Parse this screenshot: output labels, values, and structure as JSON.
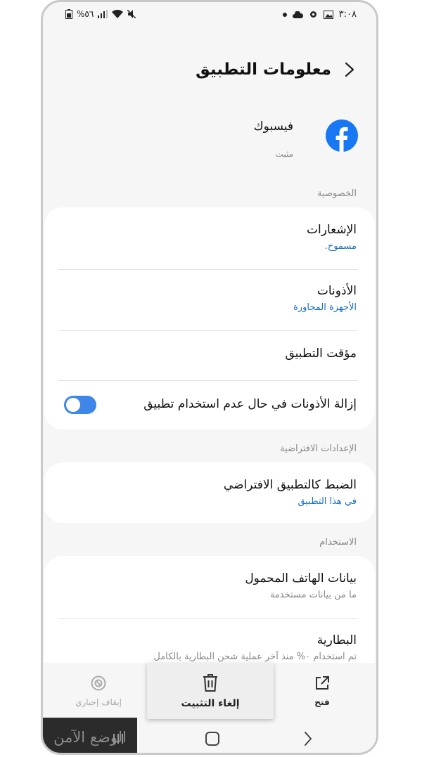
{
  "status": {
    "time": "٣:٠٨",
    "battery": "%٥٦"
  },
  "header": {
    "title": "معلومات التطبيق"
  },
  "app": {
    "name": "فيسبوك",
    "status": "مثبت"
  },
  "sections": {
    "privacy": "الخصوصية",
    "defaults": "الإعدادات الافتراضية",
    "usage": "الاستخدام"
  },
  "items": {
    "notifications": {
      "title": "الإشعارات",
      "sub": "مسموح."
    },
    "permissions": {
      "title": "الأذونات",
      "sub": "الأجهزة المجاورة"
    },
    "timer": {
      "title": "مؤقت التطبيق"
    },
    "remove_perms": {
      "title": "إزالة الأذونات في حال عدم استخدام تطبيق",
      "enabled": true
    },
    "default_app": {
      "title": "الضبط كالتطبيق الافتراضي",
      "sub": "في هذا التطبيق"
    },
    "mobile_data": {
      "title": "بيانات الهاتف المحمول",
      "sub": "ما من بيانات مستخدمة"
    },
    "battery": {
      "title": "البطارية",
      "sub": "تم استخدام ٠% منذ آخر عملية شحن البطارية بالكامل"
    }
  },
  "bottom": {
    "open": "فتح",
    "uninstall": "إلغاء التثبيت",
    "force_stop": "إيقاف إجباري"
  },
  "nav": {
    "safe_mode": "الوضع الآمن"
  },
  "colors": {
    "accent": "#1b6fc2",
    "toggle": "#3e86e8",
    "facebook": "#1877f2"
  }
}
